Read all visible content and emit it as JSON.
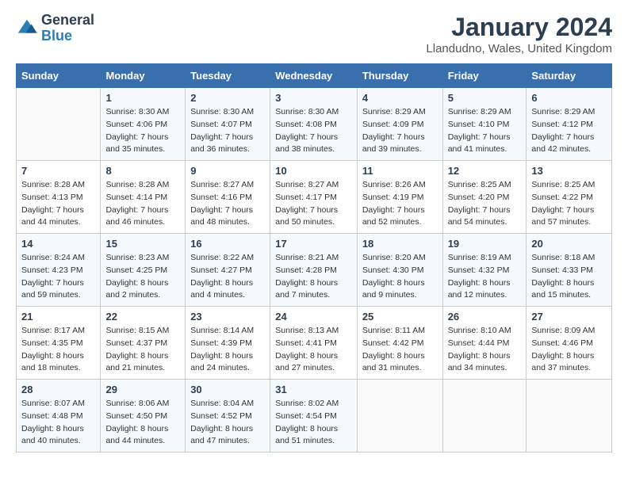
{
  "logo": {
    "text_general": "General",
    "text_blue": "Blue"
  },
  "header": {
    "month": "January 2024",
    "location": "Llandudno, Wales, United Kingdom"
  },
  "weekdays": [
    "Sunday",
    "Monday",
    "Tuesday",
    "Wednesday",
    "Thursday",
    "Friday",
    "Saturday"
  ],
  "weeks": [
    [
      {
        "day": "",
        "sunrise": "",
        "sunset": "",
        "daylight": ""
      },
      {
        "day": "1",
        "sunrise": "Sunrise: 8:30 AM",
        "sunset": "Sunset: 4:06 PM",
        "daylight": "Daylight: 7 hours and 35 minutes."
      },
      {
        "day": "2",
        "sunrise": "Sunrise: 8:30 AM",
        "sunset": "Sunset: 4:07 PM",
        "daylight": "Daylight: 7 hours and 36 minutes."
      },
      {
        "day": "3",
        "sunrise": "Sunrise: 8:30 AM",
        "sunset": "Sunset: 4:08 PM",
        "daylight": "Daylight: 7 hours and 38 minutes."
      },
      {
        "day": "4",
        "sunrise": "Sunrise: 8:29 AM",
        "sunset": "Sunset: 4:09 PM",
        "daylight": "Daylight: 7 hours and 39 minutes."
      },
      {
        "day": "5",
        "sunrise": "Sunrise: 8:29 AM",
        "sunset": "Sunset: 4:10 PM",
        "daylight": "Daylight: 7 hours and 41 minutes."
      },
      {
        "day": "6",
        "sunrise": "Sunrise: 8:29 AM",
        "sunset": "Sunset: 4:12 PM",
        "daylight": "Daylight: 7 hours and 42 minutes."
      }
    ],
    [
      {
        "day": "7",
        "sunrise": "Sunrise: 8:28 AM",
        "sunset": "Sunset: 4:13 PM",
        "daylight": "Daylight: 7 hours and 44 minutes."
      },
      {
        "day": "8",
        "sunrise": "Sunrise: 8:28 AM",
        "sunset": "Sunset: 4:14 PM",
        "daylight": "Daylight: 7 hours and 46 minutes."
      },
      {
        "day": "9",
        "sunrise": "Sunrise: 8:27 AM",
        "sunset": "Sunset: 4:16 PM",
        "daylight": "Daylight: 7 hours and 48 minutes."
      },
      {
        "day": "10",
        "sunrise": "Sunrise: 8:27 AM",
        "sunset": "Sunset: 4:17 PM",
        "daylight": "Daylight: 7 hours and 50 minutes."
      },
      {
        "day": "11",
        "sunrise": "Sunrise: 8:26 AM",
        "sunset": "Sunset: 4:19 PM",
        "daylight": "Daylight: 7 hours and 52 minutes."
      },
      {
        "day": "12",
        "sunrise": "Sunrise: 8:25 AM",
        "sunset": "Sunset: 4:20 PM",
        "daylight": "Daylight: 7 hours and 54 minutes."
      },
      {
        "day": "13",
        "sunrise": "Sunrise: 8:25 AM",
        "sunset": "Sunset: 4:22 PM",
        "daylight": "Daylight: 7 hours and 57 minutes."
      }
    ],
    [
      {
        "day": "14",
        "sunrise": "Sunrise: 8:24 AM",
        "sunset": "Sunset: 4:23 PM",
        "daylight": "Daylight: 7 hours and 59 minutes."
      },
      {
        "day": "15",
        "sunrise": "Sunrise: 8:23 AM",
        "sunset": "Sunset: 4:25 PM",
        "daylight": "Daylight: 8 hours and 2 minutes."
      },
      {
        "day": "16",
        "sunrise": "Sunrise: 8:22 AM",
        "sunset": "Sunset: 4:27 PM",
        "daylight": "Daylight: 8 hours and 4 minutes."
      },
      {
        "day": "17",
        "sunrise": "Sunrise: 8:21 AM",
        "sunset": "Sunset: 4:28 PM",
        "daylight": "Daylight: 8 hours and 7 minutes."
      },
      {
        "day": "18",
        "sunrise": "Sunrise: 8:20 AM",
        "sunset": "Sunset: 4:30 PM",
        "daylight": "Daylight: 8 hours and 9 minutes."
      },
      {
        "day": "19",
        "sunrise": "Sunrise: 8:19 AM",
        "sunset": "Sunset: 4:32 PM",
        "daylight": "Daylight: 8 hours and 12 minutes."
      },
      {
        "day": "20",
        "sunrise": "Sunrise: 8:18 AM",
        "sunset": "Sunset: 4:33 PM",
        "daylight": "Daylight: 8 hours and 15 minutes."
      }
    ],
    [
      {
        "day": "21",
        "sunrise": "Sunrise: 8:17 AM",
        "sunset": "Sunset: 4:35 PM",
        "daylight": "Daylight: 8 hours and 18 minutes."
      },
      {
        "day": "22",
        "sunrise": "Sunrise: 8:15 AM",
        "sunset": "Sunset: 4:37 PM",
        "daylight": "Daylight: 8 hours and 21 minutes."
      },
      {
        "day": "23",
        "sunrise": "Sunrise: 8:14 AM",
        "sunset": "Sunset: 4:39 PM",
        "daylight": "Daylight: 8 hours and 24 minutes."
      },
      {
        "day": "24",
        "sunrise": "Sunrise: 8:13 AM",
        "sunset": "Sunset: 4:41 PM",
        "daylight": "Daylight: 8 hours and 27 minutes."
      },
      {
        "day": "25",
        "sunrise": "Sunrise: 8:11 AM",
        "sunset": "Sunset: 4:42 PM",
        "daylight": "Daylight: 8 hours and 31 minutes."
      },
      {
        "day": "26",
        "sunrise": "Sunrise: 8:10 AM",
        "sunset": "Sunset: 4:44 PM",
        "daylight": "Daylight: 8 hours and 34 minutes."
      },
      {
        "day": "27",
        "sunrise": "Sunrise: 8:09 AM",
        "sunset": "Sunset: 4:46 PM",
        "daylight": "Daylight: 8 hours and 37 minutes."
      }
    ],
    [
      {
        "day": "28",
        "sunrise": "Sunrise: 8:07 AM",
        "sunset": "Sunset: 4:48 PM",
        "daylight": "Daylight: 8 hours and 40 minutes."
      },
      {
        "day": "29",
        "sunrise": "Sunrise: 8:06 AM",
        "sunset": "Sunset: 4:50 PM",
        "daylight": "Daylight: 8 hours and 44 minutes."
      },
      {
        "day": "30",
        "sunrise": "Sunrise: 8:04 AM",
        "sunset": "Sunset: 4:52 PM",
        "daylight": "Daylight: 8 hours and 47 minutes."
      },
      {
        "day": "31",
        "sunrise": "Sunrise: 8:02 AM",
        "sunset": "Sunset: 4:54 PM",
        "daylight": "Daylight: 8 hours and 51 minutes."
      },
      {
        "day": "",
        "sunrise": "",
        "sunset": "",
        "daylight": ""
      },
      {
        "day": "",
        "sunrise": "",
        "sunset": "",
        "daylight": ""
      },
      {
        "day": "",
        "sunrise": "",
        "sunset": "",
        "daylight": ""
      }
    ]
  ]
}
